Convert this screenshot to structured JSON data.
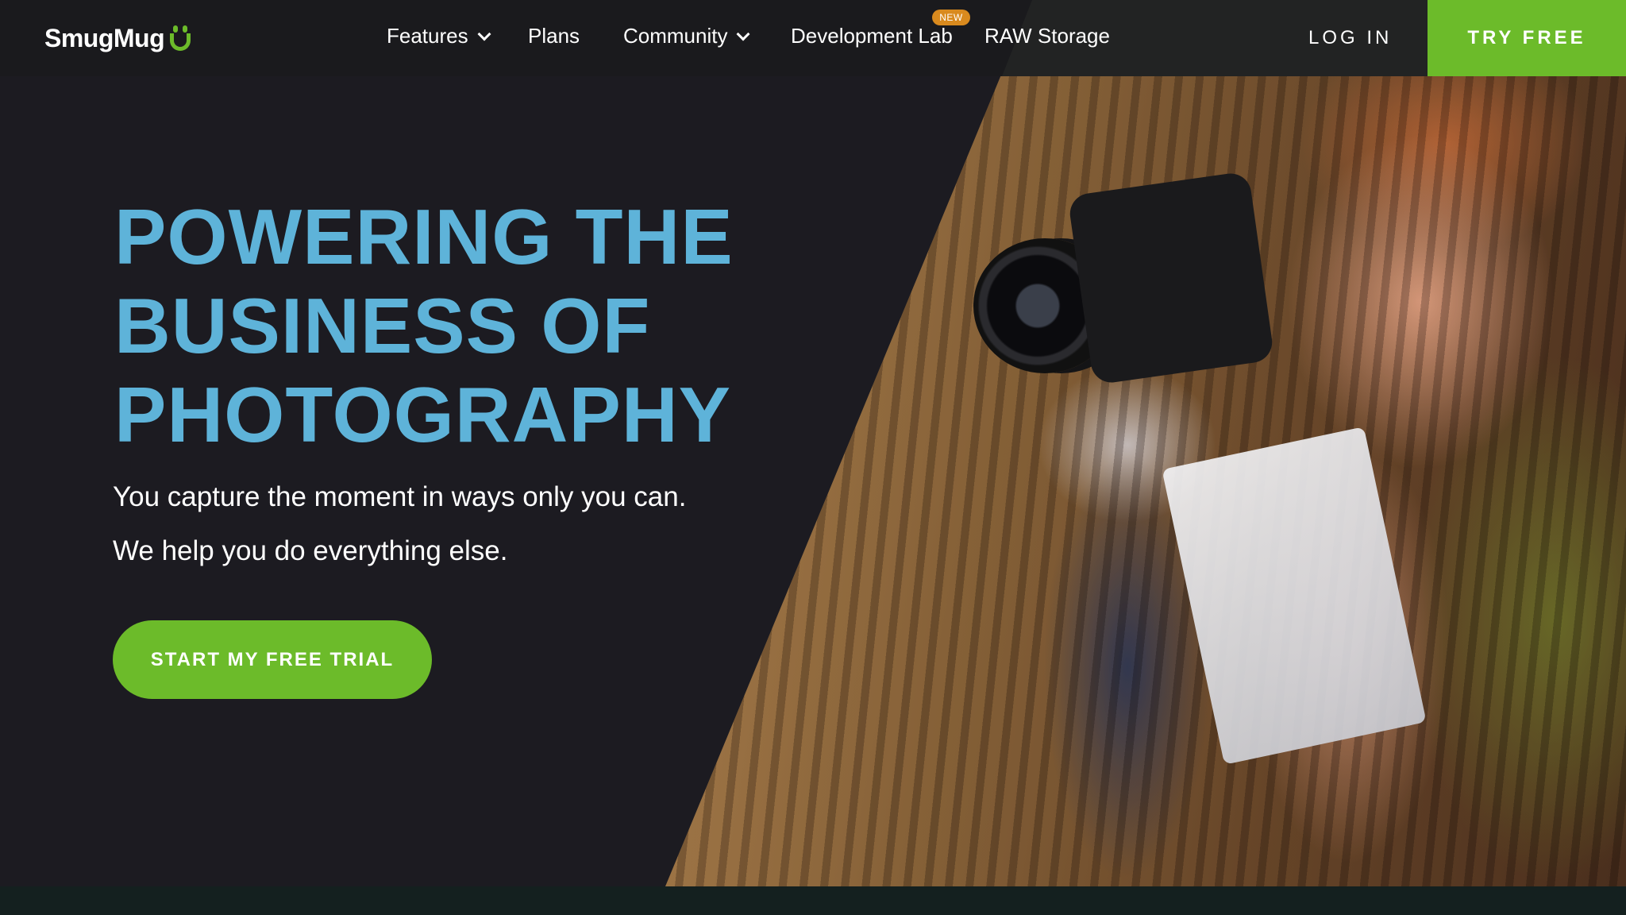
{
  "brand": {
    "name": "SmugMug",
    "accent": "#6cbb2a",
    "headline_color": "#5eb3d9"
  },
  "nav": {
    "items": [
      {
        "label": "Features",
        "has_dropdown": true
      },
      {
        "label": "Plans",
        "has_dropdown": false
      },
      {
        "label": "Community",
        "has_dropdown": true
      },
      {
        "label": "Development Lab",
        "has_dropdown": false,
        "badge": "NEW"
      },
      {
        "label": "RAW Storage",
        "has_dropdown": false
      }
    ],
    "login_label": "LOG IN",
    "try_free_label": "TRY FREE"
  },
  "hero": {
    "headline_lines": [
      "POWERING THE",
      "BUSINESS OF",
      "PHOTOGRAPHY"
    ],
    "subtext": "You capture the moment in ways only you can. We help you do everything else.",
    "cta_label": "START MY FREE TRIAL"
  }
}
